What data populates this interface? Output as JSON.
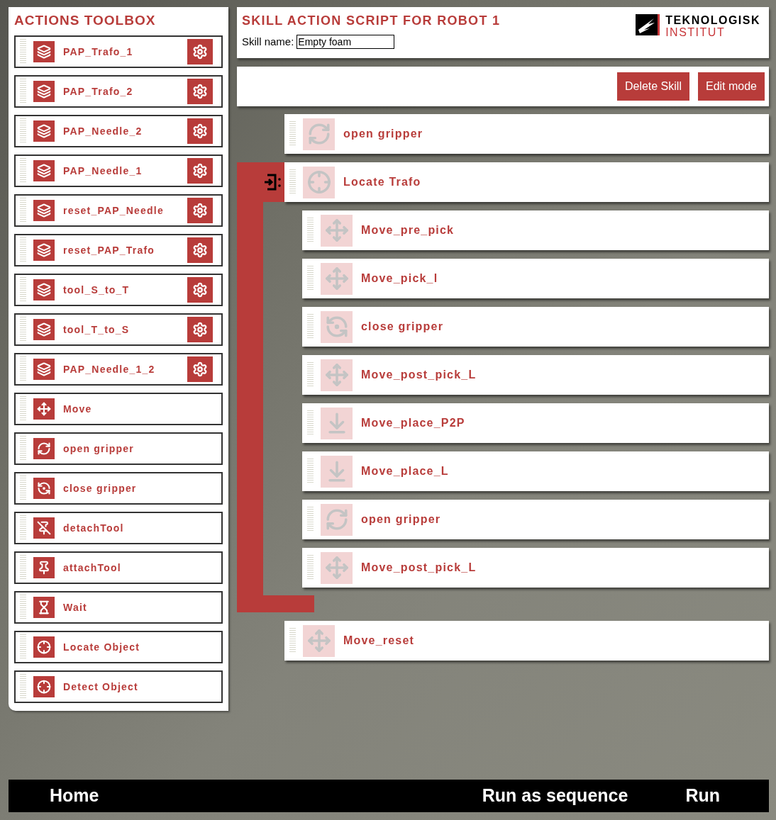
{
  "toolbox": {
    "title": "ACTIONS TOOLBOX",
    "items": [
      {
        "label": "PAP_Trafo_1",
        "kind": "layers",
        "configurable": true
      },
      {
        "label": "PAP_Trafo_2",
        "kind": "layers",
        "configurable": true
      },
      {
        "label": "PAP_Needle_2",
        "kind": "layers",
        "configurable": true
      },
      {
        "label": "PAP_Needle_1",
        "kind": "layers",
        "configurable": true
      },
      {
        "label": "reset_PAP_Needle",
        "kind": "layers",
        "configurable": true
      },
      {
        "label": "reset_PAP_Trafo",
        "kind": "layers",
        "configurable": true
      },
      {
        "label": "tool_S_to_T",
        "kind": "layers",
        "configurable": true
      },
      {
        "label": "tool_T_to_S",
        "kind": "layers",
        "configurable": true
      },
      {
        "label": "PAP_Needle_1_2",
        "kind": "layers",
        "configurable": true
      },
      {
        "label": "Move",
        "kind": "move",
        "configurable": false
      },
      {
        "label": "open gripper",
        "kind": "open",
        "configurable": false
      },
      {
        "label": "close gripper",
        "kind": "close",
        "configurable": false
      },
      {
        "label": "detachTool",
        "kind": "detach",
        "configurable": false
      },
      {
        "label": "attachTool",
        "kind": "attach",
        "configurable": false
      },
      {
        "label": "Wait",
        "kind": "wait",
        "configurable": false
      },
      {
        "label": "Locate Object",
        "kind": "locate",
        "configurable": false
      },
      {
        "label": "Detect Object",
        "kind": "locate",
        "configurable": false
      }
    ]
  },
  "header": {
    "title": "SKILL ACTION SCRIPT FOR ROBOT 1",
    "skill_name_label": "Skill name:",
    "skill_name_value": "Empty foam",
    "logo_line_1": "TEKNOLOGISK",
    "logo_line_2": "INSTITUT"
  },
  "toolbar": {
    "buttons": [
      "Delete Skill",
      "Edit mode"
    ]
  },
  "script": [
    {
      "label": "open gripper",
      "kind": "open"
    },
    {
      "label": "Locate Trafo",
      "kind": "locate",
      "children": [
        {
          "label": "Move_pre_pick",
          "kind": "move"
        },
        {
          "label": "Move_pick_l",
          "kind": "move"
        },
        {
          "label": "close gripper",
          "kind": "close"
        },
        {
          "label": "Move_post_pick_L",
          "kind": "move"
        },
        {
          "label": "Move_place_P2P",
          "kind": "place"
        },
        {
          "label": "Move_place_L",
          "kind": "place"
        },
        {
          "label": "open gripper",
          "kind": "open"
        },
        {
          "label": "Move_post_pick_L",
          "kind": "move"
        }
      ]
    },
    {
      "label": "Move_reset",
      "kind": "move"
    }
  ],
  "bottom_bar": {
    "home": "Home",
    "run_sequence": "Run as sequence",
    "run": "Run"
  }
}
